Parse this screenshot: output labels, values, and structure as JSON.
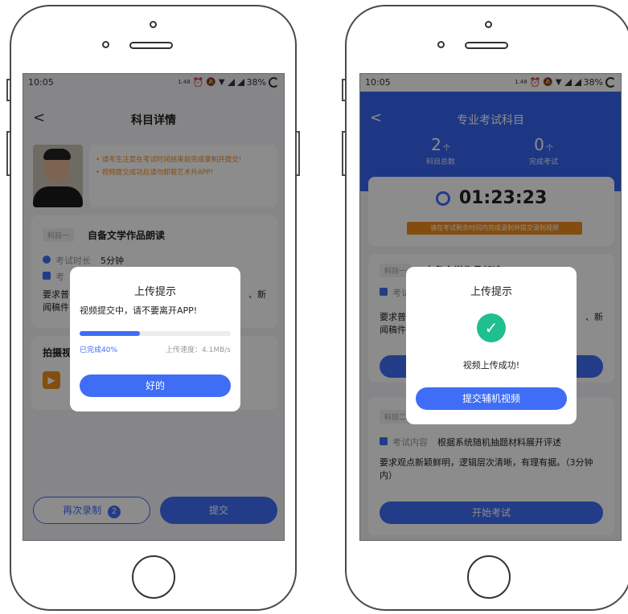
{
  "left": {
    "status": {
      "time": "10:05",
      "speed": "1.48",
      "battery": "38%"
    },
    "header": {
      "back": "<",
      "title": "科目详情"
    },
    "notice": {
      "lines": [
        "请考生注意在考试时间结束前完成录制并提交!",
        "视频提交成功后请勿卸载艺术升APP!"
      ]
    },
    "subject": {
      "tag": "科目一",
      "name": "自备文学作品朗读",
      "duration_label": "考试时长",
      "duration_value": "5分钟",
      "content_label": "考",
      "desc_a": "要求普",
      "desc_b": "闻稿件",
      "desc_suffix": "、新"
    },
    "shoot": {
      "title": "拍摄视"
    },
    "bottom": {
      "rerecord": "再次录制",
      "rerecord_count": "2",
      "submit": "提交"
    },
    "modal": {
      "title": "上传提示",
      "message": "视频提交中，请不要离开APP!",
      "progress": 0.4,
      "done_text": "已完成40%",
      "speed_text": "上传速度：4.1MB/s",
      "ok": "好的"
    }
  },
  "right": {
    "status": {
      "time": "10:05",
      "speed": "1.48",
      "battery": "38%"
    },
    "header": {
      "back": "<",
      "title": "专业考试科目"
    },
    "stats": [
      {
        "value": "2",
        "unit": "个",
        "label": "科目总数"
      },
      {
        "value": "0",
        "unit": "个",
        "label": "完成考试"
      }
    ],
    "timer": {
      "value": "01:23:23",
      "hint": "请在考试剩余时间内完成录制并提交录制视频"
    },
    "card1": {
      "tag": "科目一",
      "name": "自备文学作品朗读",
      "content_label": "考试",
      "desc_a": "要求普",
      "desc_b": "闻稿件",
      "desc_suffix": "、新"
    },
    "card2": {
      "tag": "科目二",
      "content_label": "考试内容",
      "content_value": "根据系统随机抽题材料展开评述",
      "desc": "要求观点新颖鲜明，逻辑层次清晰，有理有据。（3分钟内）",
      "start": "开始考试"
    },
    "modal": {
      "title": "上传提示",
      "message": "视频上传成功!",
      "button": "提交辅机视频"
    }
  },
  "colors": {
    "accent": "#3f6df6",
    "orange": "#f08c1e",
    "header_blue": "#3564f0"
  }
}
